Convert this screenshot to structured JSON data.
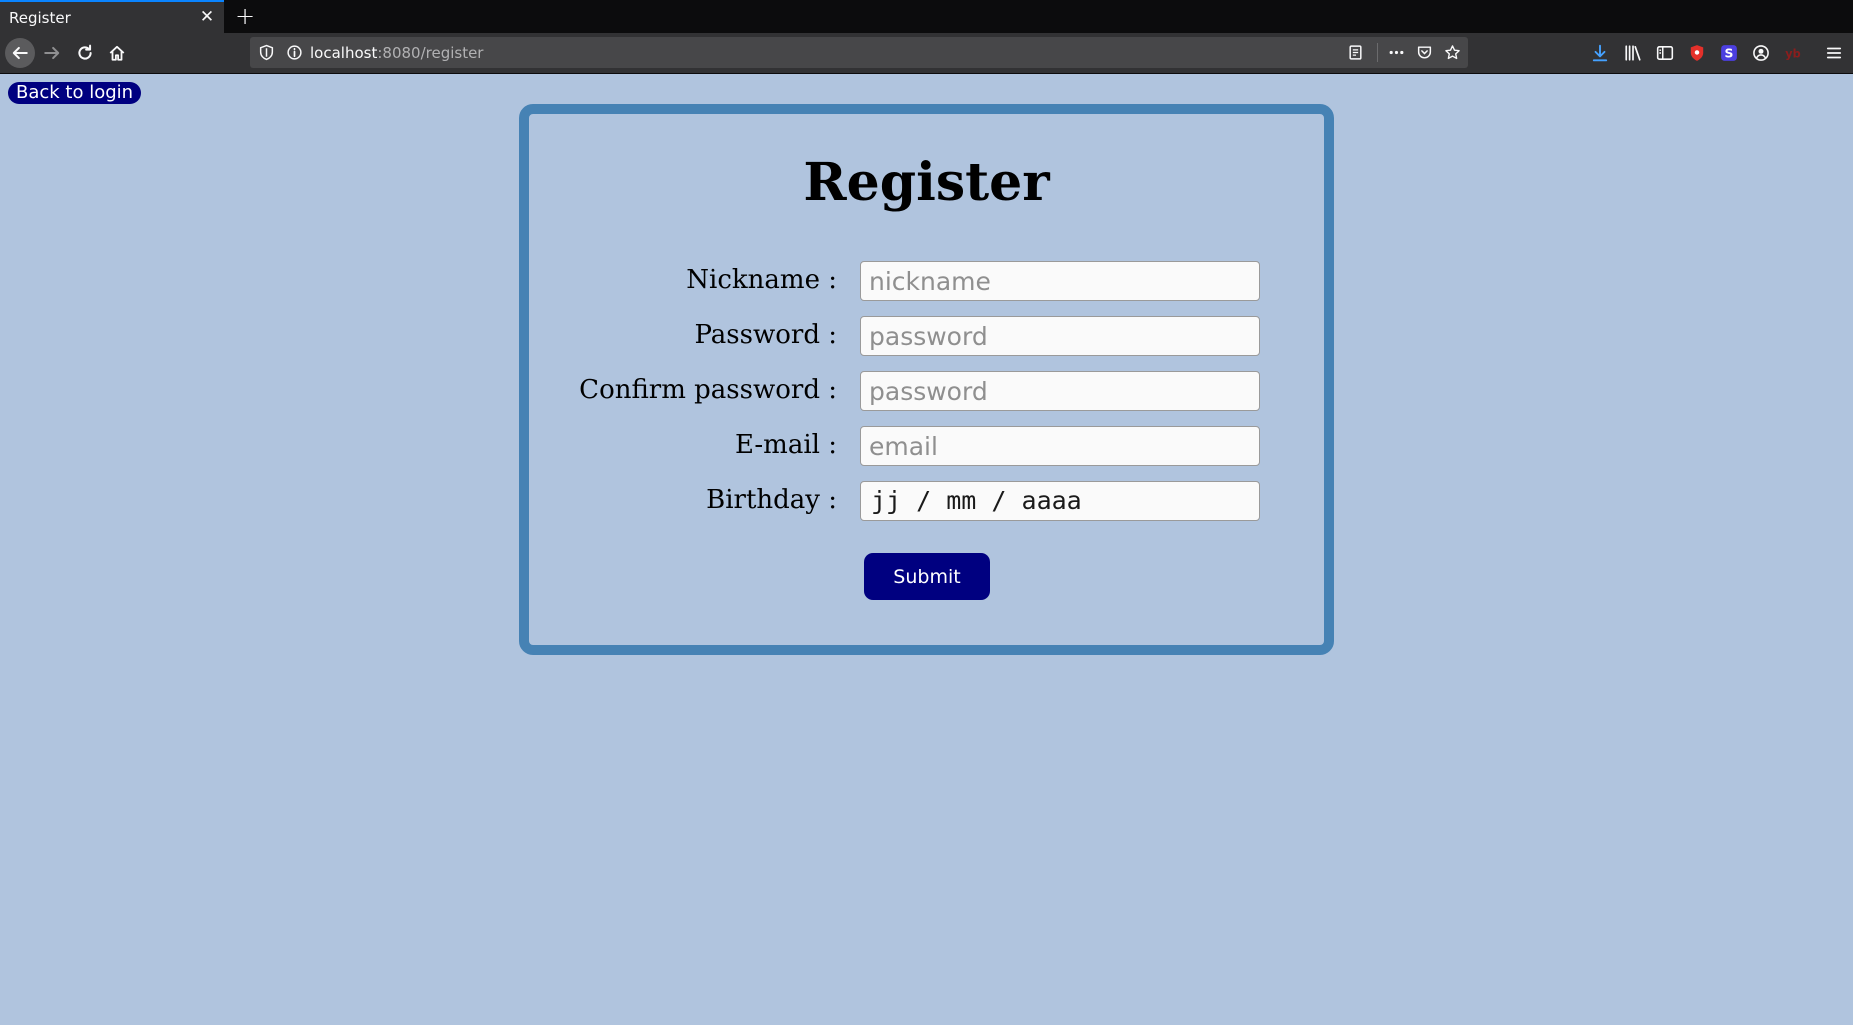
{
  "browser": {
    "tab_title": "Register",
    "tab_close": "✕",
    "new_tab": "+",
    "url_host": "localhost",
    "url_rest": ":8080/register"
  },
  "page": {
    "back_link": "Back to login",
    "title": "Register",
    "fields": [
      {
        "label": "Nickname :",
        "placeholder": "nickname",
        "type": "text"
      },
      {
        "label": "Password :",
        "placeholder": "password",
        "type": "password"
      },
      {
        "label": "Confirm password :",
        "placeholder": "password",
        "type": "password"
      },
      {
        "label": "E-mail :",
        "placeholder": "email",
        "type": "email"
      },
      {
        "label": "Birthday :",
        "value": "jj / mm / aaaa",
        "type": "date"
      }
    ],
    "submit_label": "Submit"
  },
  "colors": {
    "page_background": "#b0c4de",
    "card_border": "#4682b4",
    "button": "#000080"
  },
  "icons": [
    "back-arrow-icon",
    "forward-arrow-icon",
    "reload-icon",
    "home-icon",
    "shield-icon",
    "info-icon",
    "reader-view-icon",
    "more-icon",
    "pocket-icon",
    "star-icon",
    "download-icon",
    "library-icon",
    "sidebar-icon",
    "extension-red-icon",
    "extension-s-icon",
    "account-icon",
    "extension-yb-icon",
    "menu-icon"
  ]
}
